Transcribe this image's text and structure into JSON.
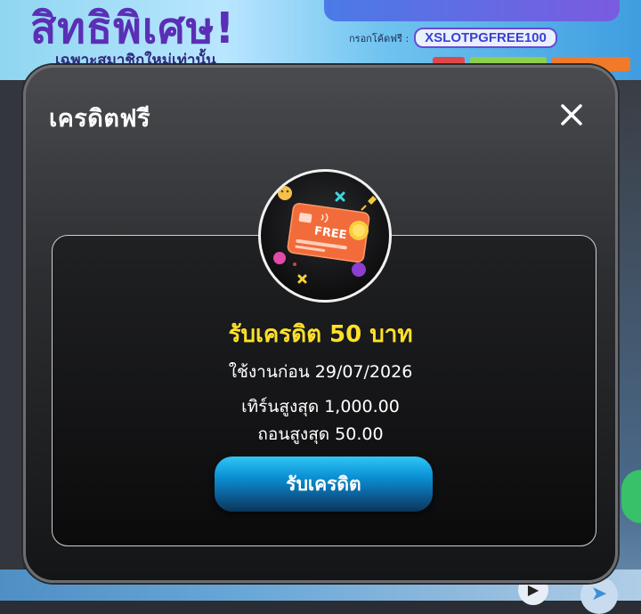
{
  "background": {
    "promo_title": "สิทธิพิเศษ!",
    "promo_subtitle": "เฉพาะสมาชิกใหม่เท่านั้น",
    "code_label": "กรอกโค้ดฟรี :",
    "promo_code": "XSLOTPGFREE100"
  },
  "modal": {
    "title": "เครดิตฟรี",
    "close_icon": "close-icon",
    "card_icon": "free-credit-card-icon",
    "reward_title": "รับเครดิต 50 บาท",
    "expire_text": "ใช้งานก่อน 29/07/2026",
    "turnover_text": "เทิร์นสูงสุด 1,000.00",
    "withdraw_text": "ถอนสูงสุด 50.00",
    "claim_button_label": "รับเครดิต"
  },
  "colors": {
    "reward_yellow": "#ffe02a",
    "button_blue": "#0a8fd4",
    "card_orange": "#f26b3a"
  }
}
